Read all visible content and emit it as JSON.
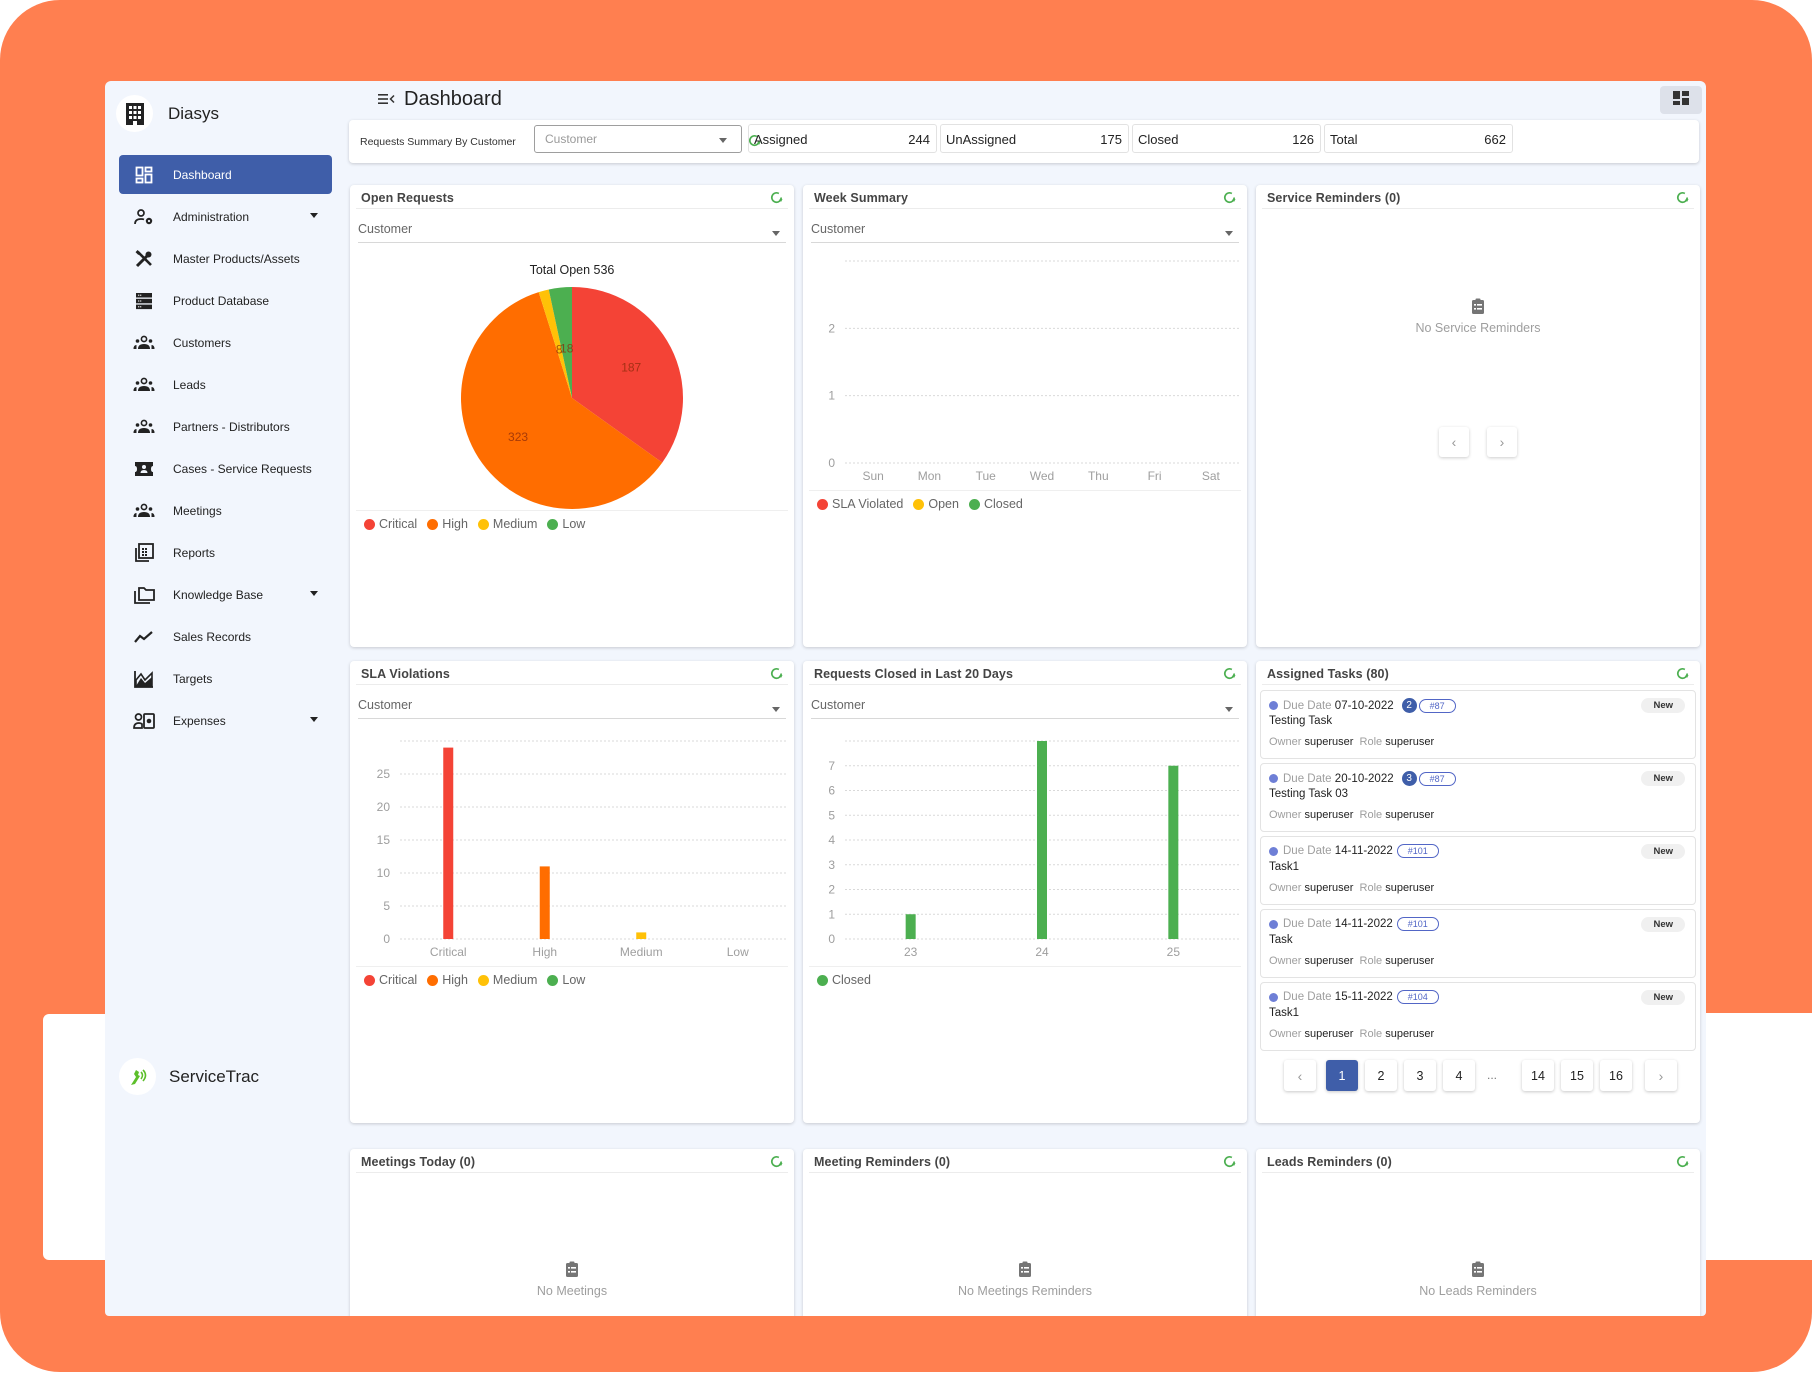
{
  "app": {
    "org_name": "Diasys",
    "product_name": "ServiceTrac",
    "page_title": "Dashboard"
  },
  "colors": {
    "accent": "#3f5ea9",
    "frame": "#ff7f50",
    "critical": "#f44336",
    "high": "#ff6d00",
    "medium": "#ffc107",
    "low": "#4caf50",
    "refresh": "#4caf50"
  },
  "sidebar": {
    "items": [
      {
        "label": "Dashboard",
        "icon": "dashboard-icon",
        "active": true,
        "expandable": false
      },
      {
        "label": "Administration",
        "icon": "admin-settings-icon",
        "active": false,
        "expandable": true
      },
      {
        "label": "Master Products/Assets",
        "icon": "tools-icon",
        "active": false,
        "expandable": false
      },
      {
        "label": "Product Database",
        "icon": "storage-icon",
        "active": false,
        "expandable": false
      },
      {
        "label": "Customers",
        "icon": "group-icon",
        "active": false,
        "expandable": false
      },
      {
        "label": "Leads",
        "icon": "group-icon",
        "active": false,
        "expandable": false
      },
      {
        "label": "Partners - Distributors",
        "icon": "group-icon",
        "active": false,
        "expandable": false
      },
      {
        "label": "Cases - Service Requests",
        "icon": "ticket-icon",
        "active": false,
        "expandable": false
      },
      {
        "label": "Meetings",
        "icon": "group-icon",
        "active": false,
        "expandable": false
      },
      {
        "label": "Reports",
        "icon": "reports-icon",
        "active": false,
        "expandable": false
      },
      {
        "label": "Knowledge Base",
        "icon": "folder-stack-icon",
        "active": false,
        "expandable": true
      },
      {
        "label": "Sales Records",
        "icon": "trend-icon",
        "active": false,
        "expandable": false
      },
      {
        "label": "Targets",
        "icon": "area-chart-icon",
        "active": false,
        "expandable": false
      },
      {
        "label": "Expenses",
        "icon": "expenses-icon",
        "active": false,
        "expandable": true
      }
    ]
  },
  "header": {
    "icons": [
      "layout-icon",
      "info-icon",
      "account-icon"
    ]
  },
  "summary": {
    "label": "Requests Summary By Customer",
    "select_placeholder": "Customer",
    "stats": [
      {
        "label": "Assigned",
        "value": "244"
      },
      {
        "label": "UnAssigned",
        "value": "175"
      },
      {
        "label": "Closed",
        "value": "126"
      },
      {
        "label": "Total",
        "value": "662"
      }
    ]
  },
  "panels": {
    "open_requests": {
      "title": "Open Requests",
      "filter": "Customer"
    },
    "week_summary": {
      "title": "Week Summary",
      "filter": "Customer"
    },
    "service_reminders": {
      "title": "Service Reminders (0)",
      "empty_text": "No Service Reminders",
      "prev": "‹",
      "next": "›"
    },
    "sla_violations": {
      "title": "SLA Violations",
      "filter": "Customer"
    },
    "requests_closed": {
      "title": "Requests Closed in Last 20 Days",
      "filter": "Customer"
    },
    "assigned_tasks": {
      "title": "Assigned Tasks (80)",
      "due_label": "Due Date",
      "owner_label": "Owner",
      "role_label": "Role",
      "tasks": [
        {
          "due": "07-10-2022",
          "count": "2",
          "ref": "#87",
          "title": "Testing Task",
          "owner": "superuser",
          "role": "superuser",
          "status": "New"
        },
        {
          "due": "20-10-2022",
          "count": "3",
          "ref": "#87",
          "title": "Testing Task 03",
          "owner": "superuser",
          "role": "superuser",
          "status": "New"
        },
        {
          "due": "14-11-2022",
          "count": null,
          "ref": "#101",
          "title": "Task1",
          "owner": "superuser",
          "role": "superuser",
          "status": "New"
        },
        {
          "due": "14-11-2022",
          "count": null,
          "ref": "#101",
          "title": "Task",
          "owner": "superuser",
          "role": "superuser",
          "status": "New"
        },
        {
          "due": "15-11-2022",
          "count": null,
          "ref": "#104",
          "title": "Task1",
          "owner": "superuser",
          "role": "superuser",
          "status": "New"
        }
      ],
      "pagination": {
        "prev": "‹",
        "next": "›",
        "pages": [
          "1",
          "2",
          "3",
          "4",
          "...",
          "14",
          "15",
          "16"
        ],
        "current": "1"
      }
    },
    "meetings_today": {
      "title": "Meetings Today (0)",
      "empty_text": "No Meetings"
    },
    "meeting_reminders": {
      "title": "Meeting Reminders (0)",
      "empty_text": "No Meetings Reminders"
    },
    "leads_reminders": {
      "title": "Leads Reminders (0)",
      "empty_text": "No Leads Reminders"
    }
  },
  "chart_data": [
    {
      "id": "open_requests",
      "type": "pie",
      "title": "Total Open 536",
      "categories": [
        "Critical",
        "High",
        "Medium",
        "Low"
      ],
      "values": [
        187,
        323,
        8,
        18
      ],
      "colors": [
        "#f44336",
        "#ff6d00",
        "#ffc107",
        "#4caf50"
      ],
      "legend": [
        "Critical",
        "High",
        "Medium",
        "Low"
      ],
      "legend_position": "bottom-left"
    },
    {
      "id": "week_summary",
      "type": "bar",
      "title": "",
      "categories": [
        "Sun",
        "Mon",
        "Tue",
        "Wed",
        "Thu",
        "Fri",
        "Sat"
      ],
      "series": [
        {
          "name": "SLA Violated",
          "color": "#f44336",
          "values": [
            0,
            0,
            0,
            0,
            0,
            0,
            0
          ]
        },
        {
          "name": "Open",
          "color": "#ffc107",
          "values": [
            0,
            0,
            0,
            0,
            0,
            0,
            0
          ]
        },
        {
          "name": "Closed",
          "color": "#4caf50",
          "values": [
            0,
            0,
            0,
            0,
            0,
            0,
            0
          ]
        }
      ],
      "yticks": [
        0,
        1,
        2
      ],
      "ylim": [
        0,
        3
      ],
      "grid": true,
      "legend_position": "bottom-left"
    },
    {
      "id": "sla_violations",
      "type": "bar",
      "title": "",
      "categories": [
        "Critical",
        "High",
        "Medium",
        "Low"
      ],
      "values": [
        29,
        11,
        1,
        0
      ],
      "colors": [
        "#f44336",
        "#ff6d00",
        "#ffc107",
        "#4caf50"
      ],
      "yticks": [
        0,
        5,
        10,
        15,
        20,
        25
      ],
      "ylim": [
        0,
        30
      ],
      "grid": true,
      "legend": [
        "Critical",
        "High",
        "Medium",
        "Low"
      ],
      "legend_position": "bottom-left"
    },
    {
      "id": "requests_closed",
      "type": "bar",
      "title": "",
      "categories": [
        "23",
        "24",
        "25"
      ],
      "series": [
        {
          "name": "Closed",
          "color": "#4caf50",
          "values": [
            1,
            8,
            7
          ]
        }
      ],
      "yticks": [
        0,
        1,
        2,
        3,
        4,
        5,
        6,
        7
      ],
      "ylim": [
        0,
        8
      ],
      "grid": true,
      "legend_position": "bottom-left"
    }
  ]
}
